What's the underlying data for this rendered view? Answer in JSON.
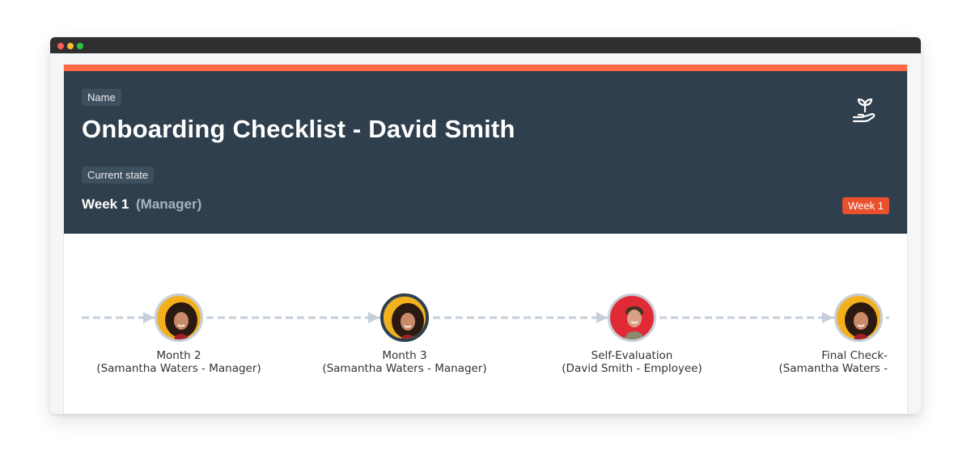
{
  "window": {
    "controls": [
      "close",
      "minimize",
      "maximize"
    ]
  },
  "header": {
    "name_label": "Name",
    "title": "Onboarding Checklist - David Smith",
    "state_label": "Current state",
    "state_value": "Week 1",
    "state_role": "(Manager)",
    "badge": "Week 1",
    "icon": "plant-in-hand-icon"
  },
  "colors": {
    "accent": "#ff6a45",
    "header_bg": "#2f3f4d",
    "badge": "#e8502e",
    "connector": "#c5cfd9"
  },
  "timeline": {
    "steps": [
      {
        "title": "Month 2",
        "subtitle": "(Samantha Waters - Manager)",
        "avatar": "female-avatar",
        "active": false
      },
      {
        "title": "Month 3",
        "subtitle": "(Samantha Waters - Manager)",
        "avatar": "female-avatar",
        "active": true
      },
      {
        "title": "Self-Evaluation",
        "subtitle": "(David Smith - Employee)",
        "avatar": "male-avatar",
        "active": false
      },
      {
        "title": "Final Check-",
        "subtitle": "(Samantha Waters -",
        "avatar": "female-avatar",
        "active": false
      }
    ]
  }
}
